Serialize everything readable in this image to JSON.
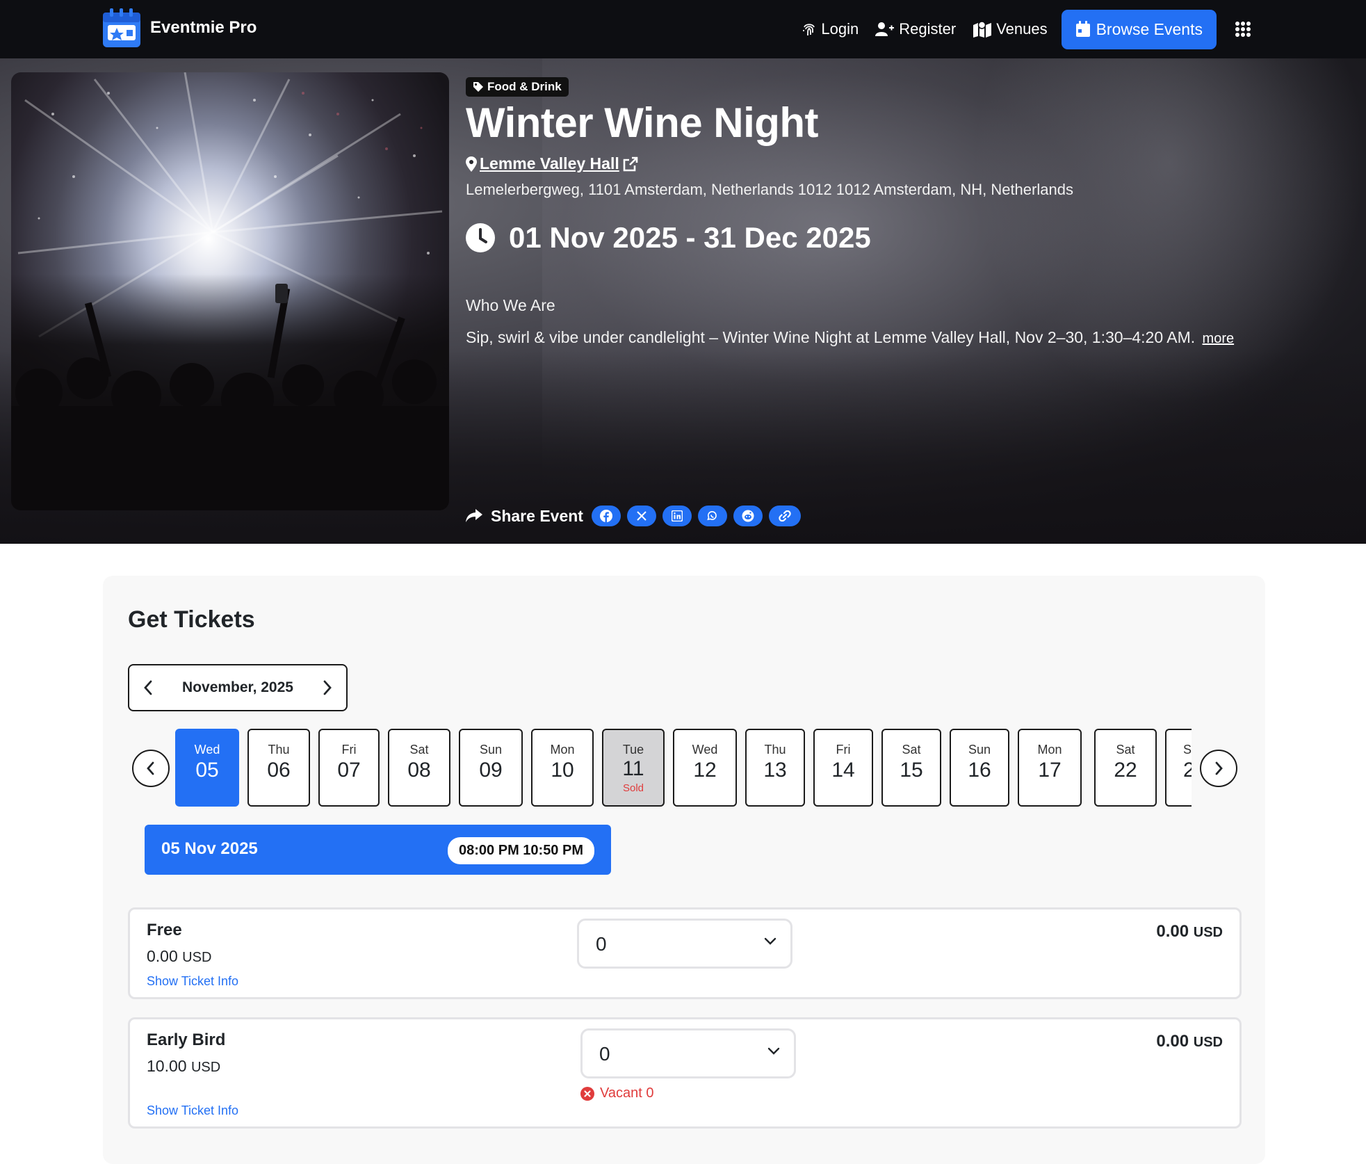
{
  "nav": {
    "brand": "Eventmie Pro",
    "login": "Login",
    "register": "Register",
    "venues": "Venues",
    "browse_events": "Browse Events"
  },
  "event": {
    "category": "Food & Drink",
    "title": "Winter Wine Night",
    "venue_name": "Lemme Valley Hall",
    "address": "Lemelerbergweg, 1101 Amsterdam, Netherlands 1012 1012 Amsterdam, NH, Netherlands",
    "date_range": "01 Nov 2025 - 31 Dec 2025",
    "about_heading": "Who We Are",
    "description": "Sip, swirl & vibe under candlelight – Winter Wine Night at Lemme Valley Hall, Nov 2–30, 1:30–4:20 AM.",
    "more": "more",
    "share_label": "Share Event",
    "share_icons": [
      "facebook-icon",
      "x-icon",
      "linkedin-icon",
      "whatsapp-icon",
      "reddit-icon",
      "link-icon"
    ]
  },
  "tickets": {
    "title": "Get Tickets",
    "month": "November, 2025",
    "days": [
      {
        "name": "Wed",
        "date": "05",
        "status": "",
        "selected": true
      },
      {
        "name": "Thu",
        "date": "06",
        "status": ""
      },
      {
        "name": "Fri",
        "date": "07",
        "status": ""
      },
      {
        "name": "Sat",
        "date": "08",
        "status": ""
      },
      {
        "name": "Sun",
        "date": "09",
        "status": ""
      },
      {
        "name": "Mon",
        "date": "10",
        "status": ""
      },
      {
        "name": "Tue",
        "date": "11",
        "status": "Sold"
      },
      {
        "name": "Wed",
        "date": "12",
        "status": ""
      },
      {
        "name": "Thu",
        "date": "13",
        "status": ""
      },
      {
        "name": "Fri",
        "date": "14",
        "status": ""
      },
      {
        "name": "Sat",
        "date": "15",
        "status": ""
      },
      {
        "name": "Sun",
        "date": "16",
        "status": ""
      },
      {
        "name": "Mon",
        "date": "17",
        "status": ""
      },
      {
        "name": "Sat",
        "date": "22",
        "status": ""
      },
      {
        "name": "S",
        "date": "2",
        "status": ""
      }
    ],
    "selected_date": "05 Nov 2025",
    "selected_time": "08:00 PM 10:50 PM",
    "items": [
      {
        "name": "Free",
        "price": "0.00",
        "currency": "USD",
        "qty": "0",
        "total": "0.00",
        "total_currency": "USD",
        "info": "Show Ticket Info",
        "vacant": ""
      },
      {
        "name": "Early Bird",
        "price": "10.00",
        "currency": "USD",
        "qty": "0",
        "total": "0.00",
        "total_currency": "USD",
        "info": "Show Ticket Info",
        "vacant": "Vacant 0"
      }
    ]
  },
  "colors": {
    "accent": "#2370f4",
    "navbar": "#0d0e12",
    "danger": "#e03c3c"
  }
}
